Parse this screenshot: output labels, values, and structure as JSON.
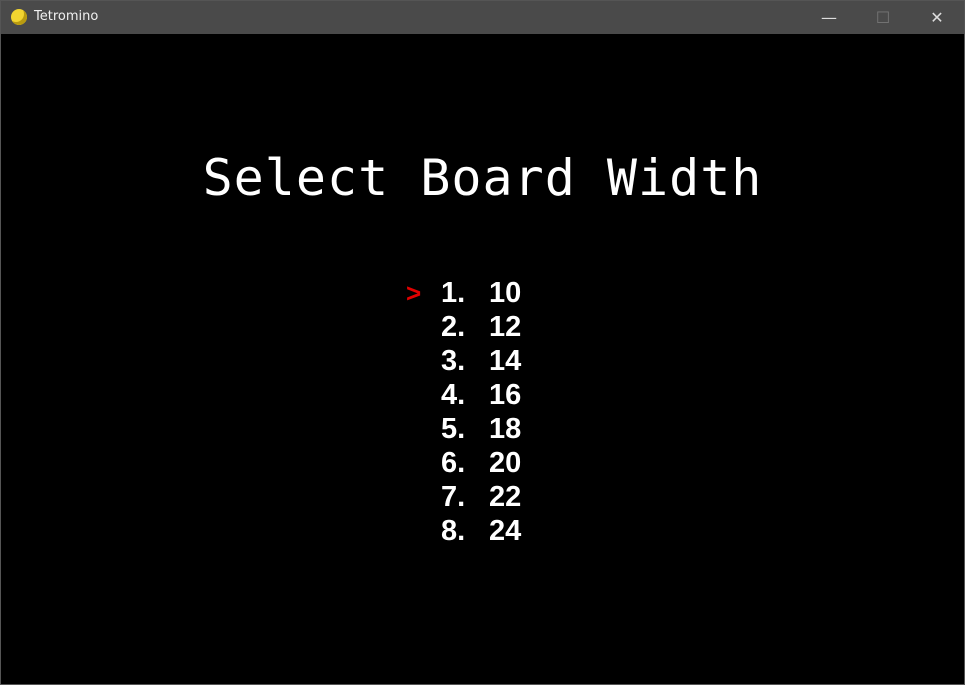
{
  "window": {
    "title": "Tetromino",
    "minimize": "—",
    "maximize": "☐",
    "close": "✕"
  },
  "screen": {
    "heading": "Select Board Width",
    "cursor": ">",
    "selected_index": 0,
    "options": [
      {
        "number": "1.",
        "value": "10"
      },
      {
        "number": "2.",
        "value": "12"
      },
      {
        "number": "3.",
        "value": "14"
      },
      {
        "number": "4.",
        "value": "16"
      },
      {
        "number": "5.",
        "value": "18"
      },
      {
        "number": "6.",
        "value": "20"
      },
      {
        "number": "7.",
        "value": "22"
      },
      {
        "number": "8.",
        "value": "24"
      }
    ]
  }
}
